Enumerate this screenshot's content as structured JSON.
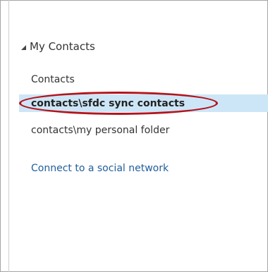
{
  "folder_pane": {
    "group": {
      "label": "My Contacts",
      "icon": "collapse-triangle-icon"
    },
    "items": [
      {
        "label": "Contacts",
        "selected": false
      },
      {
        "label": "contacts\\sfdc sync contacts",
        "selected": true
      },
      {
        "label": "contacts\\my personal folder",
        "selected": false
      }
    ],
    "social_link": "Connect to a social network"
  },
  "colors": {
    "selection_background": "#cde6f7",
    "highlight_circle": "#b3141c",
    "link": "#1f5e9c"
  }
}
